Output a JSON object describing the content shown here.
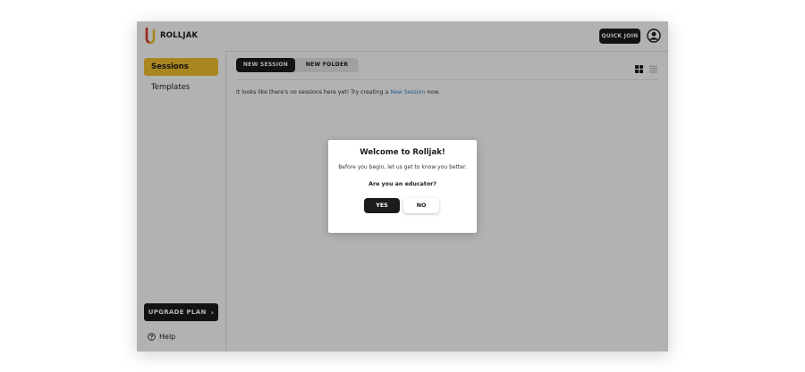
{
  "app": {
    "brand": "ROLLJAK"
  },
  "header": {
    "quick_join_label": "QUICK JOIN"
  },
  "sidebar": {
    "items": [
      {
        "label": "Sessions",
        "active": true
      },
      {
        "label": "Templates",
        "active": false
      }
    ],
    "upgrade_label": "UPGRADE PLAN",
    "help_label": "Help"
  },
  "main": {
    "tabs": [
      {
        "label": "NEW SESSION"
      },
      {
        "label": "NEW FOLDER"
      }
    ],
    "empty_prefix": "It looks like there's no sessions here yet! Try creating a ",
    "empty_link": "New Session",
    "empty_suffix": " now."
  },
  "modal": {
    "title": "Welcome to Rolljak!",
    "subtitle": "Before you begin, let us get to know you better.",
    "question": "Are you an educator?",
    "yes_label": "YES",
    "no_label": "NO"
  },
  "colors": {
    "accent": "#f2c02e",
    "dark": "#1c1c1c",
    "link": "#3a86d4",
    "logo_red": "#e0393e",
    "logo_yellow": "#f2c02e"
  },
  "icons": {
    "logo": "rolljak-logo",
    "avatar": "user-circle-icon",
    "grid": "grid-view-icon",
    "list": "list-view-icon",
    "help": "help-circle-icon"
  }
}
